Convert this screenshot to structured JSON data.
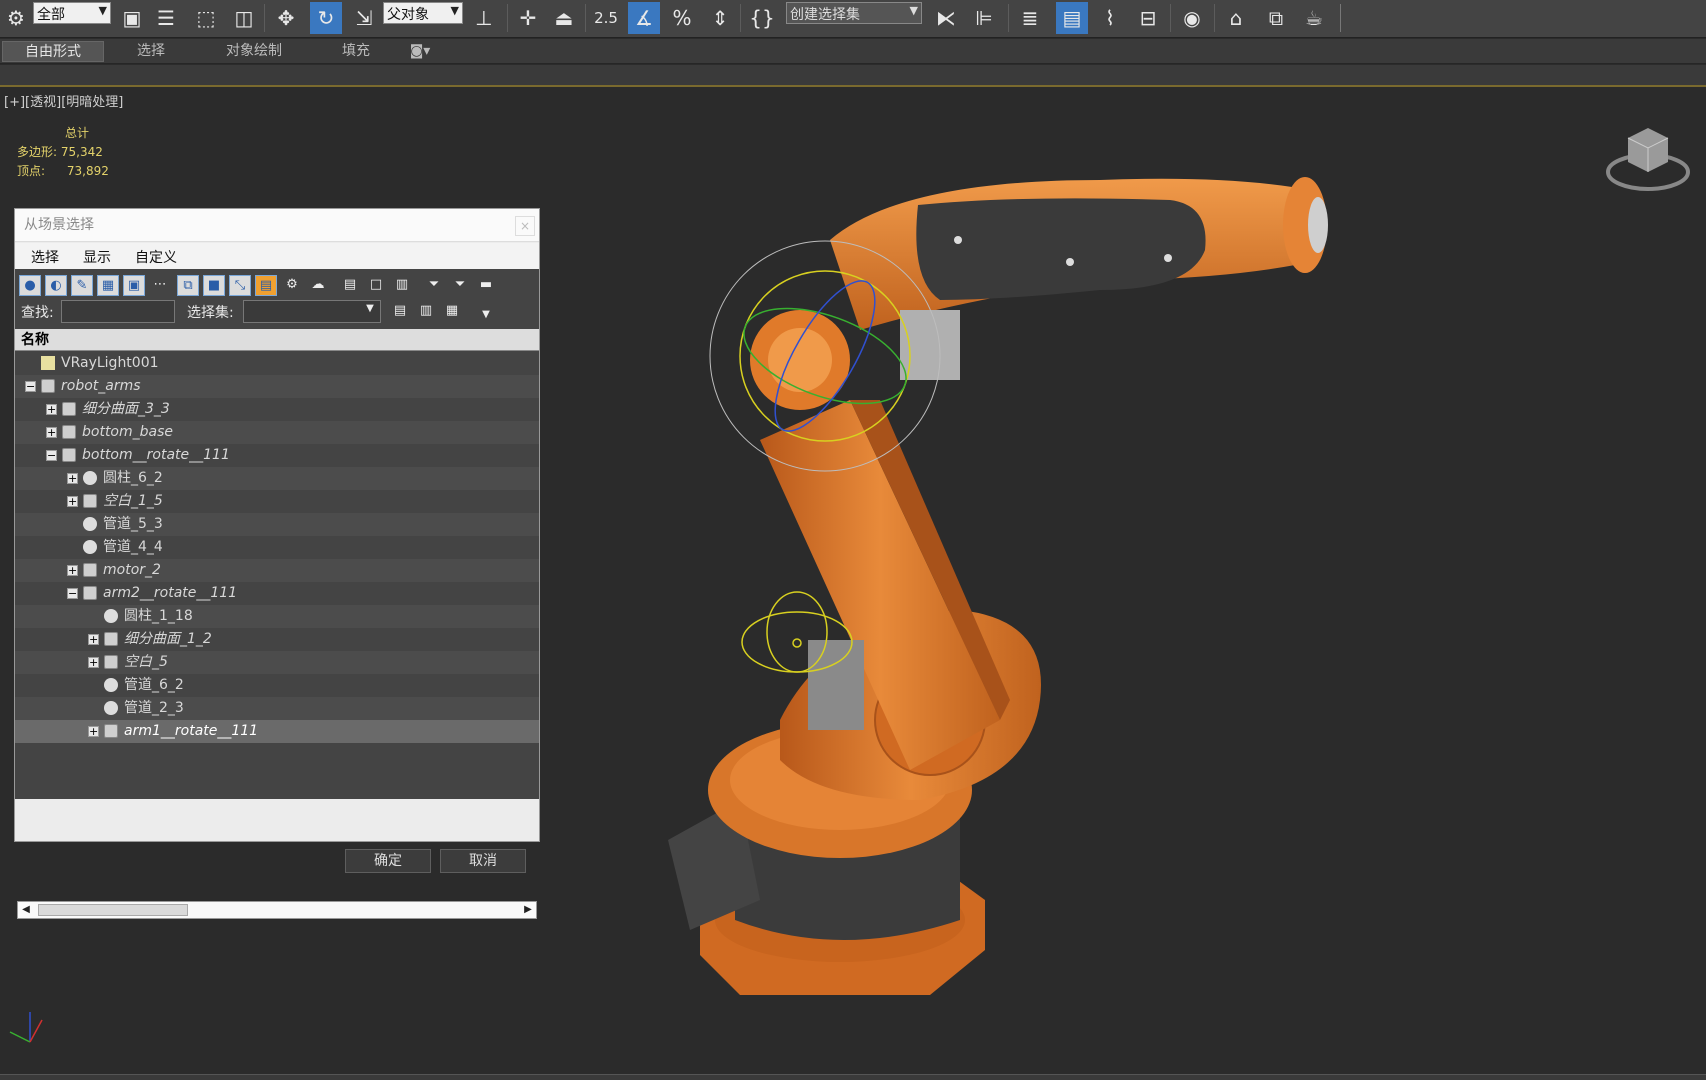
{
  "toolbar": {
    "selection_filter": "全部",
    "reference_coord": "父对象",
    "snap_angle_label": "2.5",
    "percent_label": "%",
    "named_selection_set": "创建选择集"
  },
  "tabs": [
    "自由形式",
    "选择",
    "对象绘制",
    "填充"
  ],
  "viewport": {
    "label_plus": "[+]",
    "label_view": "[透视]",
    "label_shading": "[明暗处理]"
  },
  "stats": {
    "header": "总计",
    "polys_label": "多边形:",
    "polys_value": "75,342",
    "verts_label": "顶点:",
    "verts_value": "73,892"
  },
  "dialog": {
    "title": "从场景选择",
    "menu": [
      "选择",
      "显示",
      "自定义"
    ],
    "find_label": "查找:",
    "set_label": "选择集:",
    "column_header": "名称",
    "ok": "确定",
    "cancel": "取消",
    "tree": [
      {
        "label": "VRayLight001",
        "indent": 0,
        "toggle": "",
        "icon": "light-icon",
        "italic": false
      },
      {
        "label": "robot_arms",
        "indent": 0,
        "toggle": "−",
        "icon": "group-icon",
        "italic": true
      },
      {
        "label": "细分曲面_3_3",
        "indent": 1,
        "toggle": "+",
        "icon": "group-icon",
        "italic": true
      },
      {
        "label": "bottom_base",
        "indent": 1,
        "toggle": "+",
        "icon": "group-icon",
        "italic": true
      },
      {
        "label": "bottom__rotate__111",
        "indent": 1,
        "toggle": "−",
        "icon": "group-icon",
        "italic": true
      },
      {
        "label": "圆柱_6_2",
        "indent": 2,
        "toggle": "+",
        "icon": "sphere-icon",
        "italic": false
      },
      {
        "label": "空白_1_5",
        "indent": 2,
        "toggle": "+",
        "icon": "group-icon",
        "italic": true
      },
      {
        "label": "管道_5_3",
        "indent": 2,
        "toggle": "",
        "icon": "sphere-icon",
        "italic": false
      },
      {
        "label": "管道_4_4",
        "indent": 2,
        "toggle": "",
        "icon": "sphere-icon",
        "italic": false
      },
      {
        "label": "motor_2",
        "indent": 2,
        "toggle": "+",
        "icon": "group-icon",
        "italic": true
      },
      {
        "label": "arm2__rotate__111",
        "indent": 2,
        "toggle": "−",
        "icon": "group-icon",
        "italic": true
      },
      {
        "label": "圆柱_1_18",
        "indent": 3,
        "toggle": "",
        "icon": "sphere-icon",
        "italic": false
      },
      {
        "label": "细分曲面_1_2",
        "indent": 3,
        "toggle": "+",
        "icon": "group-icon",
        "italic": true
      },
      {
        "label": "空白_5",
        "indent": 3,
        "toggle": "+",
        "icon": "group-icon",
        "italic": true
      },
      {
        "label": "管道_6_2",
        "indent": 3,
        "toggle": "",
        "icon": "sphere-icon",
        "italic": false
      },
      {
        "label": "管道_2_3",
        "indent": 3,
        "toggle": "",
        "icon": "sphere-icon",
        "italic": false
      },
      {
        "label": "arm1__rotate__111",
        "indent": 3,
        "toggle": "+",
        "icon": "group-icon",
        "italic": true,
        "selected": true
      }
    ]
  },
  "colors": {
    "robot_orange": "#e07a2a",
    "robot_dark": "#3a3a3a",
    "selection_blue": "#3a78c0",
    "stats_yellow": "#e3d26a",
    "gizmo_yellow": "#d8d020"
  }
}
